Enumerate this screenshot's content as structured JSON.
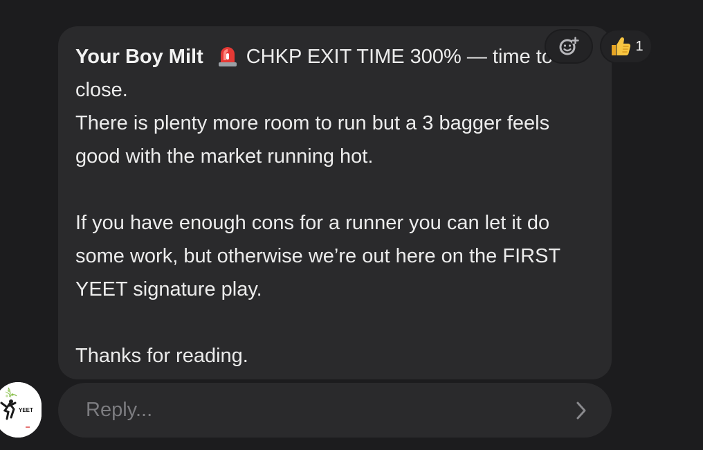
{
  "message": {
    "sender": "Your Boy Milt",
    "line1": "CHKP EXIT TIME 300% — time to close.",
    "line2": "There is plenty more room to run but a 3 bagger feels good with the market running hot.",
    "line3": "If you have enough cons for a runner you can let it do some work, but otherwise we’re out here on the FIRST YEET signature play.",
    "line4": "Thanks for reading.",
    "emoji_icon": "rotating-light-icon"
  },
  "reactions": {
    "add_icon": "add-reaction-icon",
    "thumbs_up_icon": "thumbs-up-icon",
    "thumbs_up_count": "1"
  },
  "avatar": {
    "label": "YEET"
  },
  "reply": {
    "placeholder": "Reply...",
    "send_icon": "chevron-right-icon"
  },
  "colors": {
    "background": "#1c1c1e",
    "bubble": "#2a2a2c",
    "text": "#ececec",
    "placeholder": "#7c7c80"
  }
}
